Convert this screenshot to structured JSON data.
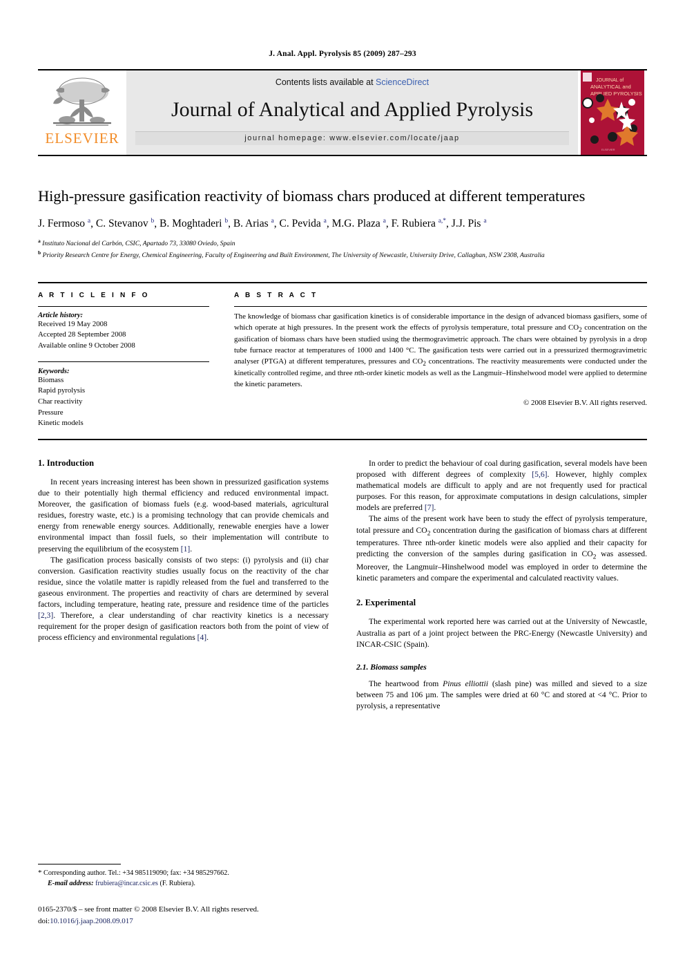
{
  "running_head": "J. Anal. Appl. Pyrolysis 85 (2009) 287–293",
  "masthead": {
    "contents_prefix": "Contents lists available at ",
    "sciencedirect": "ScienceDirect",
    "journal_title": "Journal of Analytical and Applied Pyrolysis",
    "homepage": "journal homepage: www.elsevier.com/locate/jaap",
    "publisher_wordmark": "ELSEVIER",
    "cover_title_line1": "JOURNAL of",
    "cover_title_line2": "ANALYTICAL and",
    "cover_title_line3": "APPLIED PYROLYSIS",
    "accent_orange": "#f28c28",
    "cover_red": "#ad1237",
    "link_blue": "#3a5fb0"
  },
  "article": {
    "title": "High-pressure gasification reactivity of biomass chars produced at different temperatures",
    "authors_html": "J. Fermoso <sup>a</sup>, C. Stevanov <sup>b</sup>, B. Moghtaderi <sup>b</sup>, B. Arias <sup>a</sup>, C. Pevida <sup>a</sup>, M.G. Plaza <sup>a</sup>, F. Rubiera <sup>a,*</sup>, J.J. Pis <sup>a</sup>",
    "affiliation_a": "Instituto Nacional del Carbón, CSIC, Apartado 73, 33080 Oviedo, Spain",
    "affiliation_b": "Priority Research Centre for Energy, Chemical Engineering, Faculty of Engineering and Built Environment, The University of Newcastle, University Drive, Callaghan, NSW 2308, Australia"
  },
  "article_info": {
    "heading": "A R T I C L E  I N F O",
    "history_label": "Article history:",
    "history": [
      "Received 19 May 2008",
      "Accepted 28 September 2008",
      "Available online 9 October 2008"
    ],
    "keywords_label": "Keywords:",
    "keywords": [
      "Biomass",
      "Rapid pyrolysis",
      "Char reactivity",
      "Pressure",
      "Kinetic models"
    ]
  },
  "abstract": {
    "heading": "A B S T R A C T",
    "text_html": "The knowledge of biomass char gasification kinetics is of considerable importance in the design of advanced biomass gasifiers, some of which operate at high pressures. In the present work the effects of pyrolysis temperature, total pressure and CO<sub>2</sub> concentration on the gasification of biomass chars have been studied using the thermogravimetric approach. The chars were obtained by pyrolysis in a drop tube furnace reactor at temperatures of 1000 and 1400 &deg;C. The gasification tests were carried out in a pressurized thermogravimetric analyser (PTGA) at different temperatures, pressures and CO<sub>2</sub> concentrations. The reactivity measurements were conducted under the kinetically controlled regime, and three <i>n</i>th-order kinetic models as well as the Langmuir&ndash;Hinshelwood model were applied to determine the kinetic parameters.",
    "copyright": "© 2008 Elsevier B.V. All rights reserved."
  },
  "body": {
    "section1_heading": "1. Introduction",
    "intro_p1_html": "In recent years increasing interest has been shown in pressurized gasification systems due to their potentially high thermal efficiency and reduced environmental impact. Moreover, the gasification of biomass fuels (e.g. wood-based materials, agricultural residues, forestry waste, etc.) is a promising technology that can provide chemicals and energy from renewable energy sources. Additionally, renewable energies have a lower environmental impact than fossil fuels, so their implementation will contribute to preserving the equilibrium of the ecosystem <span class=\"ref\">[1]</span>.",
    "intro_p2_html": "The gasification process basically consists of two steps: (i) pyrolysis and (ii) char conversion. Gasification reactivity studies usually focus on the reactivity of the char residue, since the volatile matter is rapidly released from the fuel and transferred to the gaseous environment. The properties and reactivity of chars are determined by several factors, including temperature, heating rate, pressure and residence time of the particles <span class=\"ref\">[2,3]</span>. Therefore, a clear understanding of char reactivity kinetics is a necessary requirement for the proper design of gasification reactors both from the point of view of process efficiency and environmental regulations <span class=\"ref\">[4]</span>.",
    "intro_p3_html": "In order to predict the behaviour of coal during gasification, several models have been proposed with different degrees of complexity <span class=\"ref\">[5,6]</span>. However, highly complex mathematical models are difficult to apply and are not frequently used for practical purposes. For this reason, for approximate computations in design calculations, simpler models are preferred <span class=\"ref\">[7]</span>.",
    "intro_p4_html": "The aims of the present work have been to study the effect of pyrolysis temperature, total pressure and CO<sub>2</sub> concentration during the gasification of biomass chars at different temperatures. Three nth-order kinetic models were also applied and their capacity for predicting the conversion of the samples during gasification in CO<sub>2</sub> was assessed. Moreover, the Langmuir&ndash;Hinshelwood model was employed in order to determine the kinetic parameters and compare the experimental and calculated reactivity values.",
    "section2_heading": "2. Experimental",
    "exp_p1_html": "The experimental work reported here was carried out at the University of Newcastle, Australia as part of a joint project between the PRC-Energy (Newcastle University) and INCAR-CSIC (Spain).",
    "subsec21_heading": "2.1. Biomass samples",
    "bio_p1_html": "The heartwood from <i>Pinus elliottii</i> (slash pine) was milled and sieved to a size between 75 and 106 &micro;m. The samples were dried at 60 &deg;C and stored at &lt;4 &deg;C. Prior to pyrolysis, a representative"
  },
  "footnote": {
    "corresponding_html": "<span class=\"star\">*</span> Corresponding author. Tel.: +34 985119090; fax: +34 985297662.",
    "email_label": "E-mail address:",
    "email": "frubiera@incar.csic.es",
    "email_owner": "(F. Rubiera)."
  },
  "imprint": {
    "line1_html": "0165-2370/$ &ndash; see front matter &copy; 2008 Elsevier B.V. All rights reserved.",
    "doi_label": "doi:",
    "doi": "10.1016/j.jaap.2008.09.017"
  }
}
